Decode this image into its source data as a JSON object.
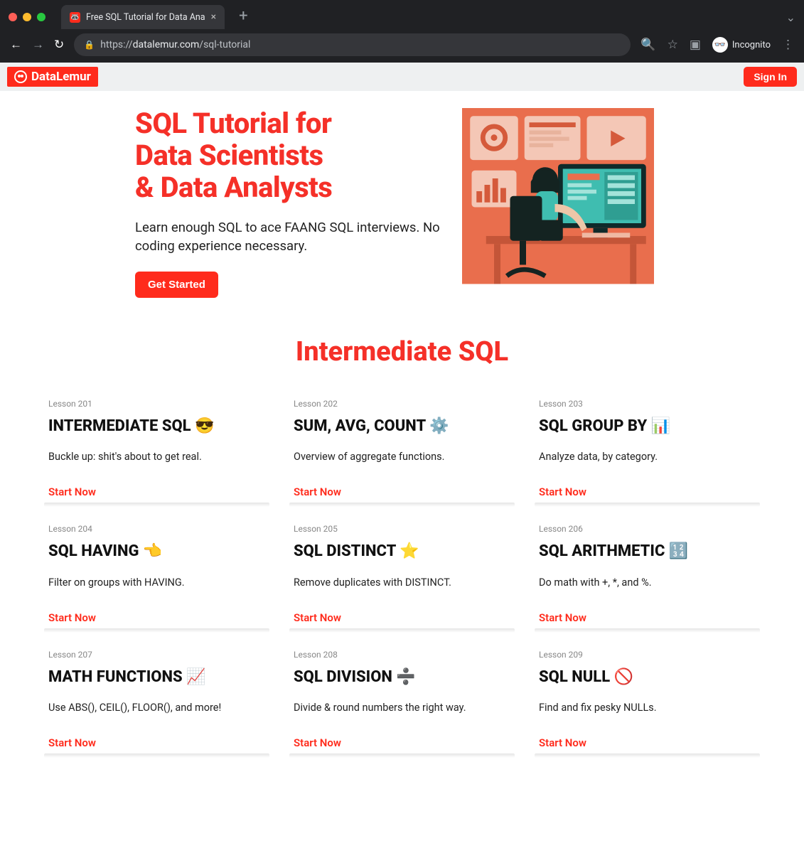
{
  "browser": {
    "tab_title": "Free SQL Tutorial for Data Ana",
    "url_prefix": "https://",
    "url_domain": "datalemur.com",
    "url_path": "/sql-tutorial",
    "incognito_label": "Incognito"
  },
  "site": {
    "brand": "DataLemur",
    "sign_in": "Sign In"
  },
  "hero": {
    "title_line1": "SQL Tutorial for",
    "title_line2": "Data Scientists",
    "title_line3": "& Data Analysts",
    "subtitle": "Learn enough SQL to ace FAANG SQL interviews. No coding experience necessary.",
    "cta": "Get Started"
  },
  "section": {
    "title": "Intermediate SQL",
    "start_label": "Start Now",
    "lessons": [
      {
        "label": "Lesson 201",
        "title": "INTERMEDIATE SQL 😎",
        "desc": "Buckle up: shit's about to get real."
      },
      {
        "label": "Lesson 202",
        "title": "SUM, AVG, COUNT ⚙️",
        "desc": "Overview of aggregate functions."
      },
      {
        "label": "Lesson 203",
        "title": "SQL GROUP BY 📊",
        "desc": "Analyze data, by category."
      },
      {
        "label": "Lesson 204",
        "title": "SQL HAVING 👈",
        "desc": "Filter on groups with HAVING."
      },
      {
        "label": "Lesson 205",
        "title": "SQL DISTINCT ⭐",
        "desc": "Remove duplicates with DISTINCT."
      },
      {
        "label": "Lesson 206",
        "title": "SQL ARITHMETIC 🔢",
        "desc": "Do math with +, *, and %."
      },
      {
        "label": "Lesson 207",
        "title": "MATH FUNCTIONS 📈",
        "desc": "Use ABS(), CEIL(), FLOOR(), and more!"
      },
      {
        "label": "Lesson 208",
        "title": "SQL DIVISION ➗",
        "desc": "Divide & round numbers the right way."
      },
      {
        "label": "Lesson 209",
        "title": "SQL NULL 🚫",
        "desc": "Find and fix pesky NULLs."
      }
    ]
  }
}
